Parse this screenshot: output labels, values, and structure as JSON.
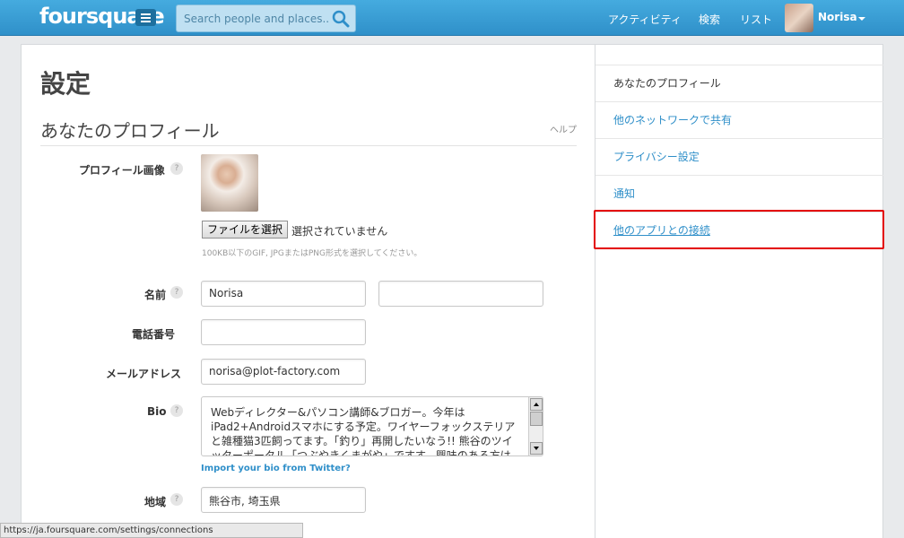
{
  "header": {
    "logo": "foursquare",
    "search_placeholder": "Search people and places...",
    "nav": [
      "アクティビティ",
      "検索",
      "リスト"
    ],
    "user_name": "Norisa"
  },
  "page": {
    "title": "設定",
    "section_title": "あなたのプロフィール",
    "help": "ヘルプ"
  },
  "form": {
    "profile_image_label": "プロフィール画像",
    "file_button": "ファイルを選択",
    "file_status": "選択されていません",
    "file_hint": "100KB以下のGIF, JPGまたはPNG形式を選択してください。",
    "name_label": "名前",
    "first_name": "Norisa",
    "last_name": "",
    "phone_label": "電話番号",
    "phone": "",
    "email_label": "メールアドレス",
    "email": "norisa@plot-factory.com",
    "bio_label": "Bio",
    "bio": "Webディレクター&パソコン講師&ブロガー。今年はiPad2+Androidスマホにする予定。ワイヤーフォックステリアと雑種猫3匹飼ってます。「釣り」再開したいなう!! 熊谷のツイッターポータル「つぶやきくまがや」ですす。興味のある方は@下さい",
    "import_bio": "Import your bio from Twitter?",
    "region_label": "地域",
    "region": "熊谷市, 埼玉県",
    "help_mark": "?"
  },
  "sidebar": {
    "items": [
      {
        "label": "あなたのプロフィール"
      },
      {
        "label": "他のネットワークで共有"
      },
      {
        "label": "プライバシー設定"
      },
      {
        "label": "通知"
      },
      {
        "label": "他のアプリとの接続"
      }
    ]
  },
  "statusbar": {
    "url": "https://ja.foursquare.com/settings/connections"
  },
  "colors": {
    "topbar": "#3a9ed6",
    "link": "#2f8fc9",
    "highlight": "#e30000"
  }
}
